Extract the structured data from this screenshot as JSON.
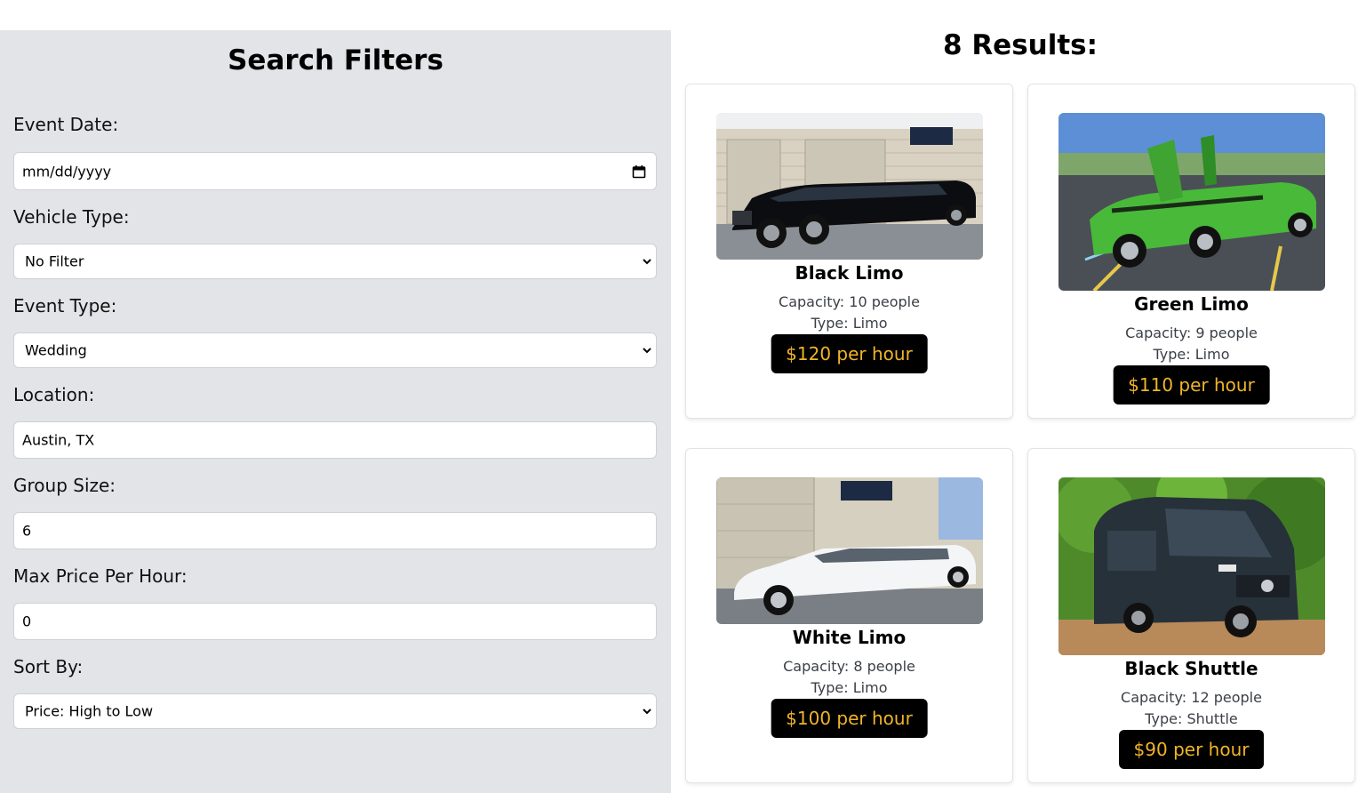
{
  "filters": {
    "title": "Search Filters",
    "event_date": {
      "label": "Event Date:",
      "placeholder": "mm/dd/yyyy"
    },
    "vehicle_type": {
      "label": "Vehicle Type:",
      "value": "No Filter"
    },
    "event_type": {
      "label": "Event Type:",
      "value": "Wedding"
    },
    "location": {
      "label": "Location:",
      "value": "Austin, TX"
    },
    "group_size": {
      "label": "Group Size:",
      "value": "6"
    },
    "max_price": {
      "label": "Max Price Per Hour:",
      "value": "0"
    },
    "sort_by": {
      "label": "Sort By:",
      "value": "Price: High to Low"
    }
  },
  "results": {
    "title": "8 Results:",
    "cards": [
      {
        "name": "Black Limo",
        "capacity": "Capacity: 10 people",
        "type": "Type: Limo",
        "price": "$120 per hour"
      },
      {
        "name": "Green Limo",
        "capacity": "Capacity: 9 people",
        "type": "Type: Limo",
        "price": "$110 per hour"
      },
      {
        "name": "White Limo",
        "capacity": "Capacity: 8 people",
        "type": "Type: Limo",
        "price": "$100 per hour"
      },
      {
        "name": "Black Shuttle",
        "capacity": "Capacity: 12 people",
        "type": "Type: Shuttle",
        "price": "$90 per hour"
      }
    ]
  },
  "colors": {
    "price_text": "#f0b429",
    "price_bg": "#000000",
    "sidebar_bg": "#e3e4e8"
  }
}
